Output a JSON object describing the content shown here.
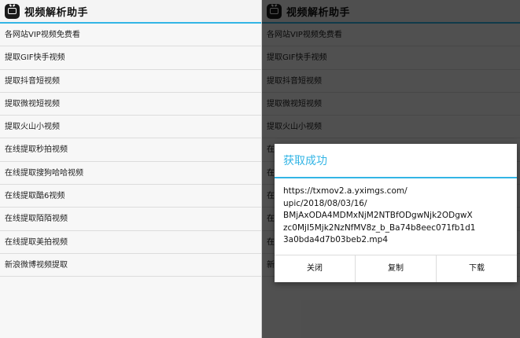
{
  "app": {
    "title": "视频解析助手"
  },
  "menu_items": [
    "各网站VIP视频免费看",
    "提取GIF快手视频",
    "提取抖音短视频",
    "提取微视短视频",
    "提取火山小视频",
    "在线提取秒拍视频",
    "在线提取搜狗哈哈视频",
    "在线提取酷6视频",
    "在线提取陌陌视频",
    "在线提取美拍视频",
    "新浪微博视频提取"
  ],
  "dialog": {
    "title": "获取成功",
    "message_lines": [
      "https://txmov2.a.yximgs.com/",
      "upic/2018/08/03/16/",
      "BMjAxODA4MDMxNjM2NTBfODgwNjk2ODgwX",
      "zc0MjI5Mjk2NzNfMV8z_b_Ba74b8eec071fb1d1",
      "3a0bda4d7b03beb2.mp4"
    ],
    "buttons": {
      "close": "关闭",
      "copy": "复制",
      "download": "下载"
    }
  },
  "colors": {
    "accent": "#33b5e5",
    "overlay": "rgba(0,0,0,0.68)"
  }
}
